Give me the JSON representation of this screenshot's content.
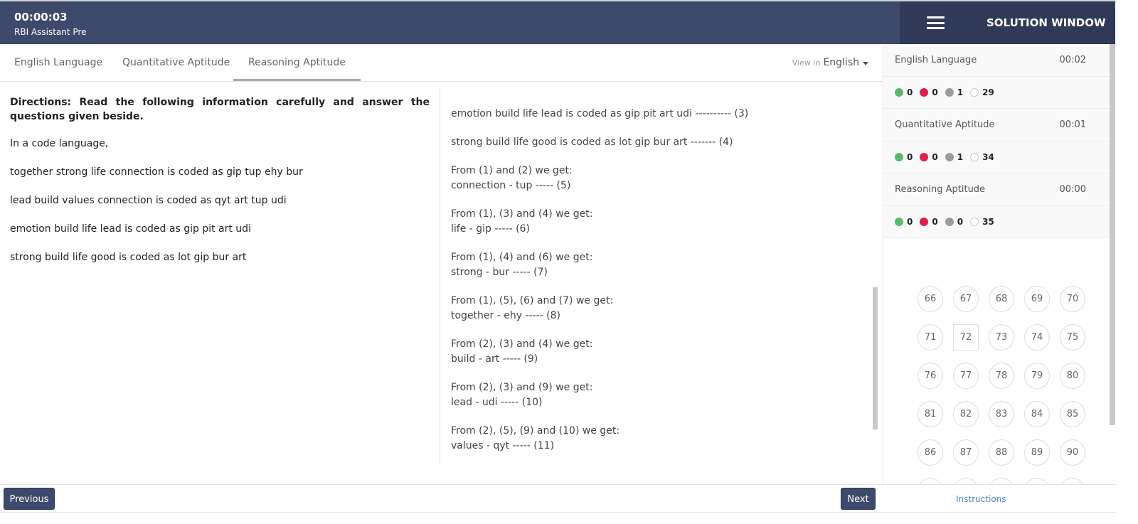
{
  "header": {
    "timer": "00:00:03",
    "exam_name": "RBI Assistant Pre",
    "solution_title": "SOLUTION WINDOW",
    "menu_icon": "hamburger-icon"
  },
  "tabs": [
    {
      "label": "English Language"
    },
    {
      "label": "Quantitative Aptitude"
    },
    {
      "label": "Reasoning Aptitude",
      "active": true
    }
  ],
  "view_in": {
    "label": "View in",
    "value": "English"
  },
  "question": {
    "directions": "Directions: Read the following information carefully and answer the questions given beside.",
    "lines": [
      "In a code language,",
      "together strong life connection is coded as gip tup ehy bur",
      "lead build values connection is coded as qyt art tup udi",
      "emotion build life lead is coded as gip pit art udi",
      "strong build life good is coded as lot gip bur art"
    ]
  },
  "solution": {
    "blocks": [
      "emotion build life lead is coded as gip pit art udi ---------- (3)",
      "strong build life good is coded as lot gip bur art ------- (4)",
      "From (1) and (2) we get:\nconnection - tup ----- (5)",
      "From (1), (3) and (4) we get:\nlife - gip ----- (6)",
      "From (1), (4) and (6) we get:\nstrong - bur ----- (7)",
      "From (1), (5), (6) and (7) we get:\ntogether - ehy ----- (8)",
      "From (2), (3) and (4) we get:\nbuild - art ----- (9)",
      "From (2), (3) and (9) we get:\nlead - udi ----- (10)",
      "From (2), (5), (9) and (10) we get:\nvalues - qyt ----- (11)"
    ]
  },
  "sections": [
    {
      "name": "English Language",
      "time": "00:02",
      "correct": "0",
      "wrong": "0",
      "skipped": "1",
      "unattempted": "29"
    },
    {
      "name": "Quantitative Aptitude",
      "time": "00:01",
      "correct": "0",
      "wrong": "0",
      "skipped": "1",
      "unattempted": "34"
    },
    {
      "name": "Reasoning Aptitude",
      "time": "00:00",
      "correct": "0",
      "wrong": "0",
      "skipped": "0",
      "unattempted": "35"
    }
  ],
  "status_colors": {
    "correct": "#5fb574",
    "wrong": "#e0204c",
    "skipped": "#9b9b9b",
    "unattempted": "#ffffff"
  },
  "palette": {
    "questions": [
      "66",
      "67",
      "68",
      "69",
      "70",
      "71",
      "72",
      "73",
      "74",
      "75",
      "76",
      "77",
      "78",
      "79",
      "80",
      "81",
      "82",
      "83",
      "84",
      "85",
      "86",
      "87",
      "88",
      "89",
      "90"
    ],
    "current": "72"
  },
  "footer": {
    "previous": "Previous",
    "next": "Next",
    "instructions": "Instructions"
  }
}
